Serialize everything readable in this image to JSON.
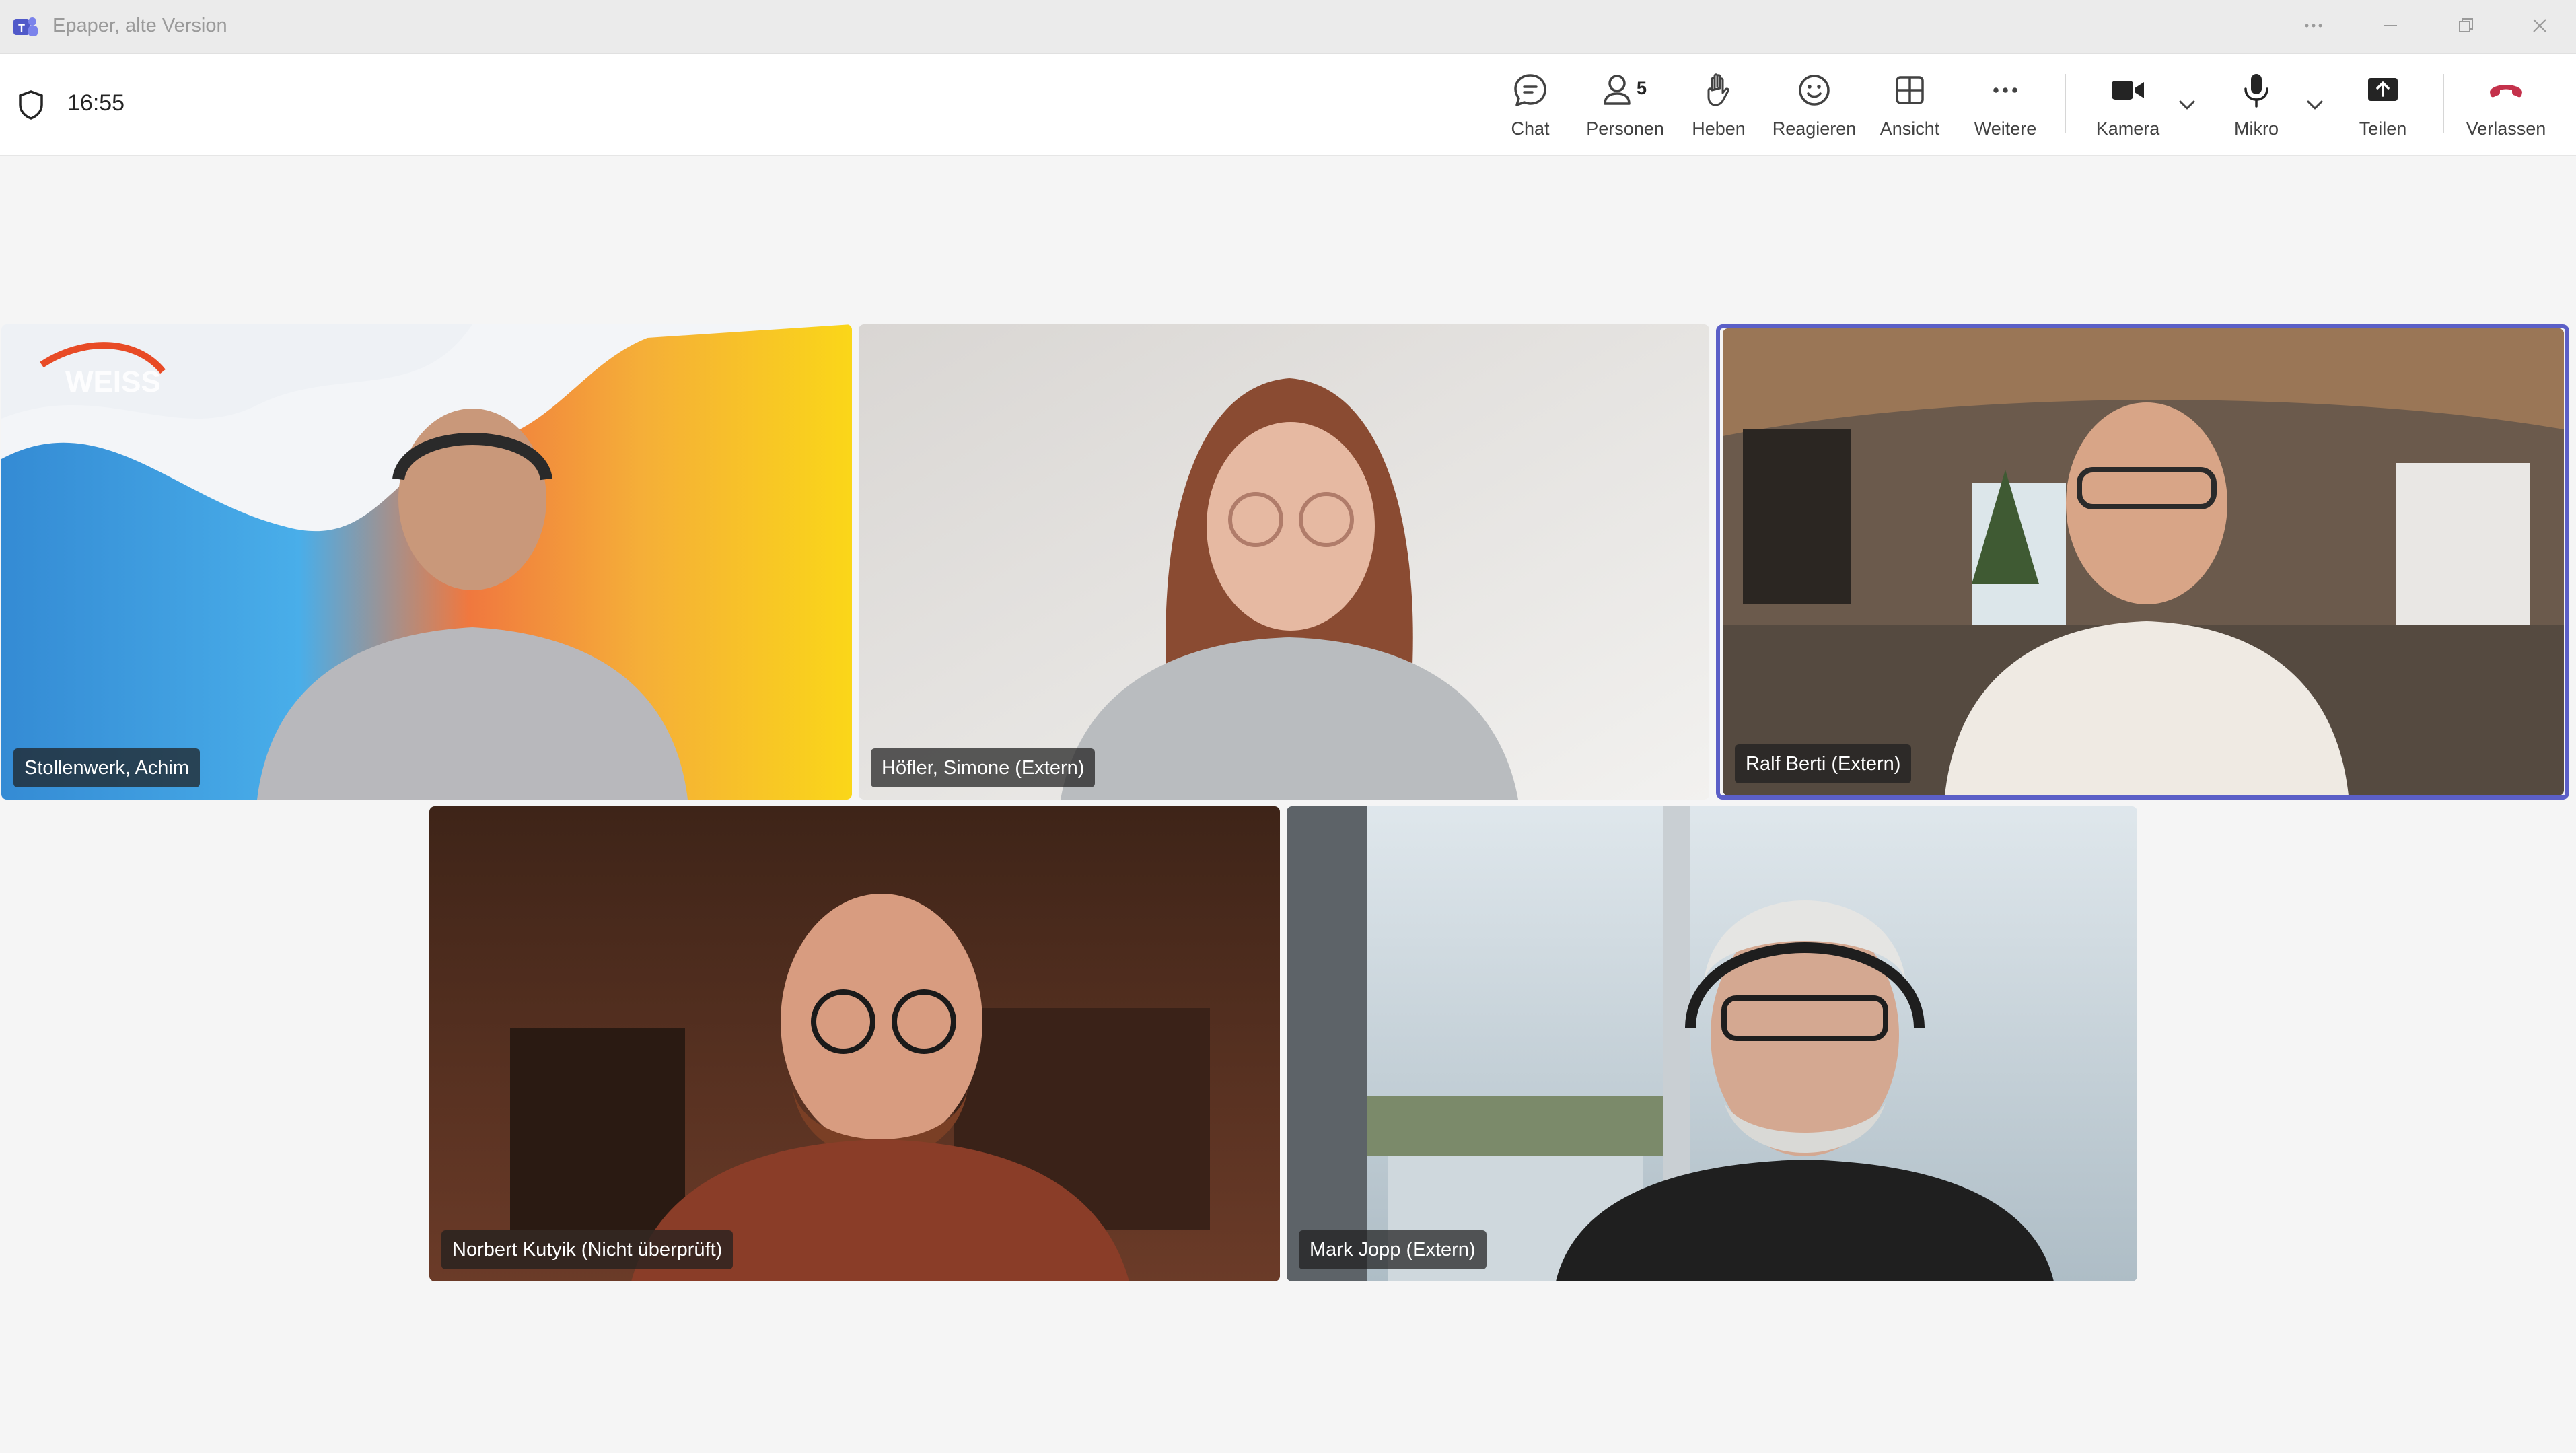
{
  "window": {
    "title": "Epaper, alte Version",
    "app_icon": "teams-icon",
    "controls": [
      "more-icon",
      "minimize-icon",
      "restore-icon",
      "close-icon"
    ]
  },
  "meeting": {
    "time": "16:55",
    "participant_count": "5"
  },
  "toolbar": {
    "chat": "Chat",
    "people": "Personen",
    "raise": "Heben",
    "react": "Reagieren",
    "view": "Ansicht",
    "more": "Weitere",
    "camera": "Kamera",
    "mic": "Mikro",
    "share": "Teilen",
    "leave": "Verlassen"
  },
  "colors": {
    "accent": "#5b5fc7",
    "leave": "#c4314b",
    "stage": "#f5f5f5"
  },
  "participants": [
    {
      "name": "Stollenwerk, Achim",
      "active": false
    },
    {
      "name": "Höfler, Simone (Extern)",
      "active": false
    },
    {
      "name": "Ralf Berti (Extern)",
      "active": true
    },
    {
      "name": "Norbert Kutyik (Nicht überprüft)",
      "active": false
    },
    {
      "name": "Mark Jopp (Extern)",
      "active": false
    }
  ]
}
